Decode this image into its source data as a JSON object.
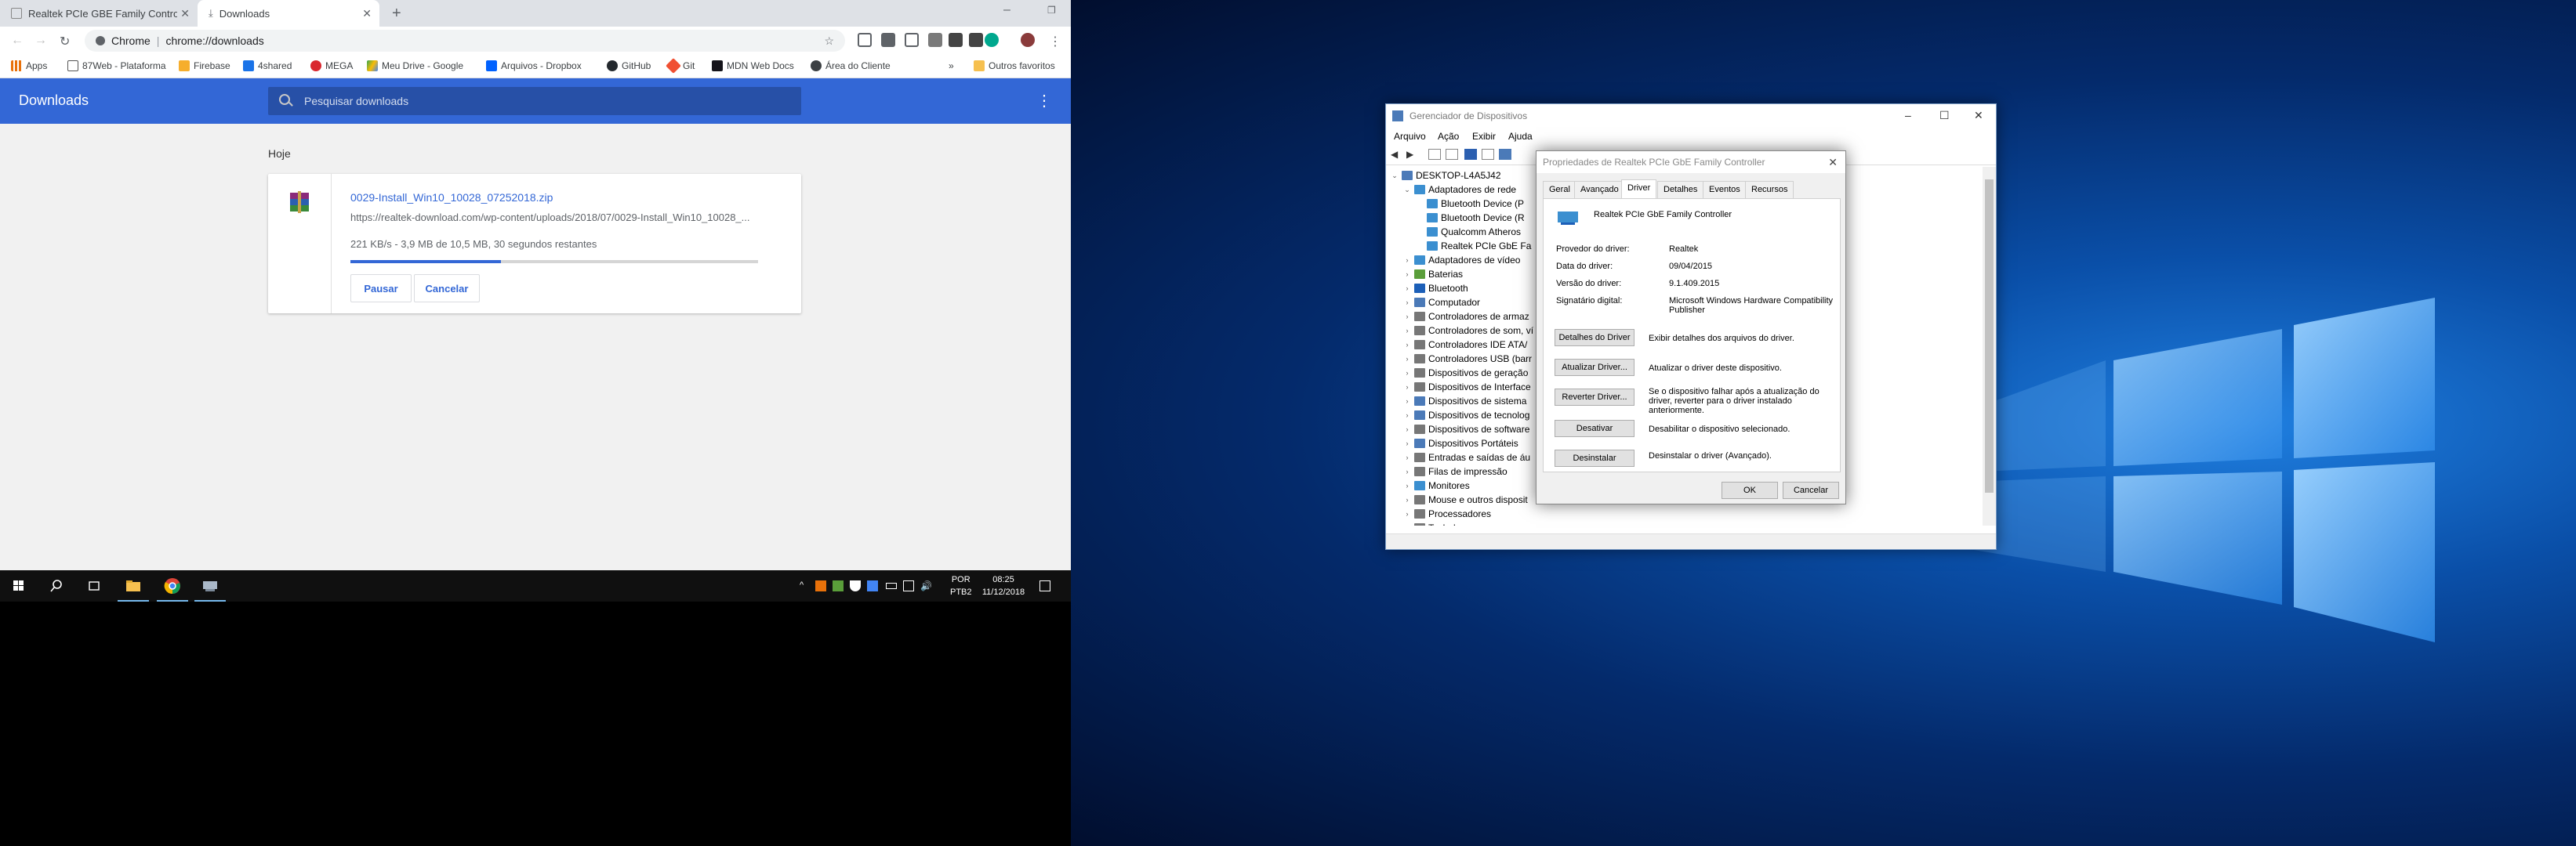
{
  "chrome": {
    "tabs": [
      {
        "title": "Realtek PCIe GBE Family Controll",
        "active": false
      },
      {
        "title": "Downloads",
        "active": true
      }
    ],
    "url_scheme": "Chrome",
    "url_path": "chrome://downloads",
    "bookmarks": [
      {
        "label": "Apps",
        "icon": "apps-grid-icon",
        "color": "#e8710a"
      },
      {
        "label": "87Web - Plataforma",
        "icon": "web-icon",
        "color": "#555555"
      },
      {
        "label": "Firebase",
        "icon": "firebase-icon",
        "color": "#f6ae2d"
      },
      {
        "label": "4shared",
        "icon": "4shared-icon",
        "color": "#1a73e8"
      },
      {
        "label": "MEGA",
        "icon": "mega-icon",
        "color": "#d9272e"
      },
      {
        "label": "Meu Drive - Google",
        "icon": "google-drive-icon",
        "color": "#34a853"
      },
      {
        "label": "Arquivos - Dropbox",
        "icon": "dropbox-icon",
        "color": "#0061fe"
      },
      {
        "label": "GitHub",
        "icon": "github-icon",
        "color": "#24292e"
      },
      {
        "label": "Git",
        "icon": "git-icon",
        "color": "#f05033"
      },
      {
        "label": "MDN Web Docs",
        "icon": "mdn-icon",
        "color": "#15141a"
      },
      {
        "label": "Área do Cliente",
        "icon": "client-area-icon",
        "color": "#3c4043"
      }
    ],
    "other_bookmarks": "Outros favoritos",
    "downloads": {
      "title": "Downloads",
      "search_placeholder": "Pesquisar downloads",
      "date_group": "Hoje",
      "item": {
        "filename": "0029-Install_Win10_10028_07252018.zip",
        "url": "https://realtek-download.com/wp-content/uploads/2018/07/0029-Install_Win10_10028_...",
        "status": "221 KB/s - 3,9 MB de 10,5 MB, 30 segundos restantes",
        "progress": 0.37,
        "pause_label": "Pausar",
        "cancel_label": "Cancelar"
      }
    }
  },
  "taskbar": {
    "lang_top": "POR",
    "lang_bottom": "PTB2",
    "time": "08:25",
    "date": "11/12/2018"
  },
  "device_manager": {
    "title": "Gerenciador de Dispositivos",
    "menu": [
      "Arquivo",
      "Ação",
      "Exibir",
      "Ajuda"
    ],
    "tree": [
      {
        "label": "DESKTOP-L4A5J42",
        "level": 0,
        "expander": "v",
        "icon_color": "#4b7ab8"
      },
      {
        "label": "Adaptadores de rede",
        "level": 1,
        "expander": "v",
        "icon_color": "#3b8fd0"
      },
      {
        "label": "Bluetooth Device (P",
        "level": 2,
        "expander": "",
        "icon_color": "#3b8fd0"
      },
      {
        "label": "Bluetooth Device (R",
        "level": 2,
        "expander": "",
        "icon_color": "#3b8fd0"
      },
      {
        "label": "Qualcomm Atheros",
        "level": 2,
        "expander": "",
        "icon_color": "#3b8fd0"
      },
      {
        "label": "Realtek PCIe GbE Fa",
        "level": 2,
        "expander": "",
        "icon_color": "#3b8fd0"
      },
      {
        "label": "Adaptadores de vídeo",
        "level": 1,
        "expander": ">",
        "icon_color": "#3b8fd0"
      },
      {
        "label": "Baterias",
        "level": 1,
        "expander": ">",
        "icon_color": "#5a9e3a"
      },
      {
        "label": "Bluetooth",
        "level": 1,
        "expander": ">",
        "icon_color": "#1c5fb8"
      },
      {
        "label": "Computador",
        "level": 1,
        "expander": ">",
        "icon_color": "#4b7ab8"
      },
      {
        "label": "Controladores de armaz",
        "level": 1,
        "expander": ">",
        "icon_color": "#777777"
      },
      {
        "label": "Controladores de som, ví",
        "level": 1,
        "expander": ">",
        "icon_color": "#777777"
      },
      {
        "label": "Controladores IDE ATA/",
        "level": 1,
        "expander": ">",
        "icon_color": "#777777"
      },
      {
        "label": "Controladores USB (barr",
        "level": 1,
        "expander": ">",
        "icon_color": "#777777"
      },
      {
        "label": "Dispositivos de geração",
        "level": 1,
        "expander": ">",
        "icon_color": "#777777"
      },
      {
        "label": "Dispositivos de Interface",
        "level": 1,
        "expander": ">",
        "icon_color": "#777777"
      },
      {
        "label": "Dispositivos de sistema",
        "level": 1,
        "expander": ">",
        "icon_color": "#4b7ab8"
      },
      {
        "label": "Dispositivos de tecnolog",
        "level": 1,
        "expander": ">",
        "icon_color": "#4b7ab8"
      },
      {
        "label": "Dispositivos de software",
        "level": 1,
        "expander": ">",
        "icon_color": "#777777"
      },
      {
        "label": "Dispositivos Portáteis",
        "level": 1,
        "expander": ">",
        "icon_color": "#4b7ab8"
      },
      {
        "label": "Entradas e saídas de áu",
        "level": 1,
        "expander": ">",
        "icon_color": "#777777"
      },
      {
        "label": "Filas de impressão",
        "level": 1,
        "expander": ">",
        "icon_color": "#777777"
      },
      {
        "label": "Monitores",
        "level": 1,
        "expander": ">",
        "icon_color": "#3b8fd0"
      },
      {
        "label": "Mouse e outros disposit",
        "level": 1,
        "expander": ">",
        "icon_color": "#777777"
      },
      {
        "label": "Processadores",
        "level": 1,
        "expander": ">",
        "icon_color": "#777777"
      },
      {
        "label": "Teclados",
        "level": 1,
        "expander": ">",
        "icon_color": "#777777"
      }
    ]
  },
  "properties": {
    "title": "Propriedades de Realtek PCIe GbE Family Controller",
    "tabs": [
      "Geral",
      "Avançado",
      "Driver",
      "Detalhes",
      "Eventos",
      "Recursos"
    ],
    "selected_tab": "Driver",
    "device_name": "Realtek PCIe GbE Family Controller",
    "fields": [
      {
        "label": "Provedor do driver:",
        "value": "Realtek"
      },
      {
        "label": "Data do driver:",
        "value": "09/04/2015"
      },
      {
        "label": "Versão do driver:",
        "value": "9.1.409.2015"
      },
      {
        "label": "Signatário digital:",
        "value": "Microsoft Windows Hardware Compatibility Publisher"
      }
    ],
    "actions": [
      {
        "button": "Detalhes do Driver",
        "desc": "Exibir detalhes dos arquivos do driver."
      },
      {
        "button": "Atualizar Driver...",
        "desc": "Atualizar o driver deste dispositivo."
      },
      {
        "button": "Reverter Driver...",
        "desc": "Se o dispositivo falhar após a atualização do driver, reverter para o driver instalado anteriormente."
      },
      {
        "button": "Desativar",
        "desc": "Desabilitar o dispositivo selecionado."
      },
      {
        "button": "Desinstalar",
        "desc": "Desinstalar o driver (Avançado)."
      }
    ],
    "ok_label": "OK",
    "cancel_label": "Cancelar"
  }
}
